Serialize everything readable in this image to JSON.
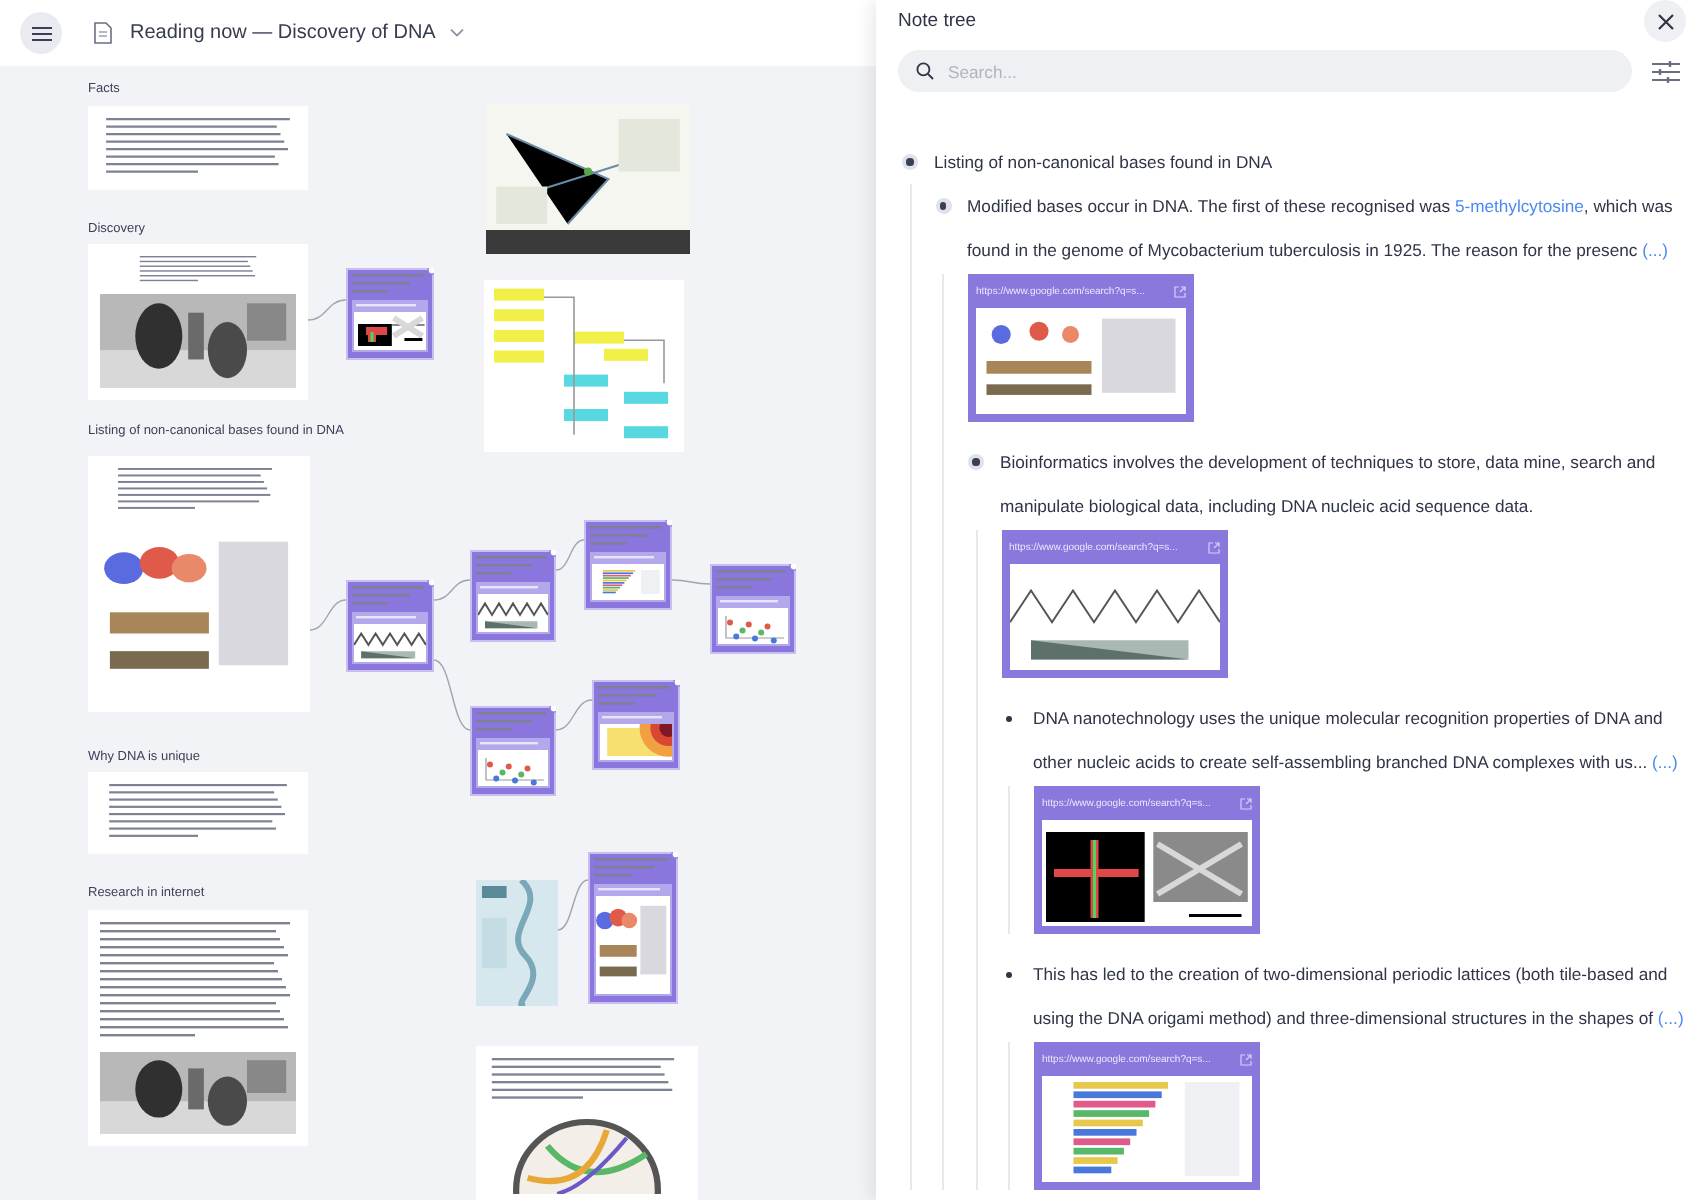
{
  "header": {
    "title": "Reading now — Discovery of DNA"
  },
  "canvas": {
    "sections": [
      {
        "heading": "Facts"
      },
      {
        "heading": "Discovery"
      },
      {
        "heading": "Listing of non-canonical bases found in DNA"
      },
      {
        "heading": "Why DNA is unique"
      },
      {
        "heading": "Research in internet"
      }
    ]
  },
  "panel": {
    "title": "Note tree",
    "search": {
      "placeholder": "Search..."
    },
    "tree": [
      {
        "text": "Listing of non-canonical bases found in DNA",
        "children": [
          {
            "text": "Modified bases occur in DNA. The first of these recognised was ",
            "link": "5-methylcytosine",
            "text_after": ", which was found in the genome of Mycobacterium tuberculosis in 1925. The reason for the presenc",
            "more": "(...)",
            "card": {
              "url": "https://www.google.com/search?q=s..."
            },
            "children": [
              {
                "text": "Bioinformatics involves the development of techniques to store, data mine, search and manipulate biological data, including DNA nucleic acid sequence data.",
                "card": {
                  "url": "https://www.google.com/search?q=s..."
                },
                "children": [
                  {
                    "text": "DNA nanotechnology uses the unique molecular recognition properties of DNA and other nucleic acids to create self-assembling branched DNA complexes with us...",
                    "more": "(...)",
                    "card": {
                      "url": "https://www.google.com/search?q=s..."
                    }
                  },
                  {
                    "text": "This has led to the creation of two-dimensional periodic lattices (both tile-based and using the DNA origami method) and three-dimensional structures in the shapes of",
                    "more": "(...)",
                    "card": {
                      "url": "https://www.google.com/search?q=s..."
                    }
                  }
                ]
              }
            ]
          }
        ]
      }
    ]
  }
}
